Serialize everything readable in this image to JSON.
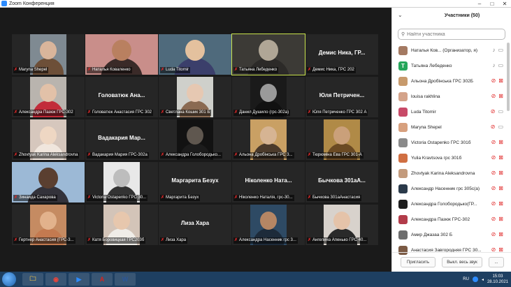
{
  "window": {
    "title": "Zoom Конференция",
    "minimize": "–",
    "maximize": "□",
    "close": "✕"
  },
  "gallery": {
    "tiles": [
      {
        "label": "Maryna Shepel",
        "center": "",
        "photo": "face",
        "bg": "#7f8a92",
        "skin": "#d9b59b",
        "cloth": "#6d4f38"
      },
      {
        "label": "Наталья Коваленко",
        "center": "",
        "photo": "full",
        "bg": "#c98e8a",
        "skin": "#b98060",
        "cloth": "#3a2a28"
      },
      {
        "label": "Luda Titomir",
        "center": "",
        "photo": "full",
        "bg": "#4f6a7c",
        "skin": "#e4c19e",
        "cloth": "#3b3f6b"
      },
      {
        "label": "Татьяна Лебеденко",
        "center": "",
        "photo": "full",
        "bg": "#3c3a36",
        "skin": "#b0a696",
        "cloth": "#2c2a28",
        "active": true
      },
      {
        "label": "Демис Ника, ГРС 202",
        "center": "Демис Ника, ГР...",
        "photo": ""
      },
      {
        "label": "Александра Пазюк ГРС-302",
        "center": "",
        "photo": "face",
        "bg": "#b9b4ae",
        "skin": "#e2c1a8",
        "cloth": "#c22c3a"
      },
      {
        "label": "Головатюк Анастасия ГРС 302",
        "center": "Головатюк Ана...",
        "photo": ""
      },
      {
        "label": "Светлана Кошик 301 Б",
        "center": "",
        "photo": "face",
        "bg": "#cfd0cb",
        "skin": "#e6c8b2",
        "cloth": "#8a6a52"
      },
      {
        "label": "Данил Душило (грс-302а)",
        "center": "",
        "photo": "face",
        "bg": "#1a1a1a",
        "skin": "#9a9a9a",
        "cloth": "#111111"
      },
      {
        "label": "Юля Петриченко ГРС 302 А",
        "center": "Юля Петричен...",
        "photo": ""
      },
      {
        "label": "Zhovtyak Karina Aleksandrovna",
        "center": "",
        "photo": "face",
        "bg": "#d6c7bd",
        "skin": "#eed7c3",
        "cloth": "#f0e6dd"
      },
      {
        "label": "Вадакария Мария ГРС-302а",
        "center": "Вадакария Мар...",
        "photo": ""
      },
      {
        "label": "Александра Голобородько...",
        "center": "",
        "photo": "face",
        "bg": "#121212",
        "skin": "#5f574f",
        "cloth": "#1c1c1c"
      },
      {
        "label": "Альона Дробінська ГРС 3...",
        "center": "",
        "photo": "face",
        "bg": "#c9a064",
        "skin": "#d6b493",
        "cloth": "#4b3a2b"
      },
      {
        "label": "Тюрюміна Ева ГРС 301-А",
        "center": "",
        "photo": "face",
        "bg": "#b08a47",
        "skin": "#caa07a",
        "cloth": "#6b4a23"
      },
      {
        "label": "Зинаида Сахарова",
        "center": "",
        "photo": "full",
        "bg": "#9cb9d6",
        "skin": "#5a3f30",
        "cloth": "#33323a"
      },
      {
        "label": "Victoria Ostapenko  ГРС 30...",
        "center": "",
        "photo": "face",
        "bg": "#e8e8e8",
        "skin": "#bdbdbd",
        "cloth": "#333333"
      },
      {
        "label": "Маргарита Безух",
        "center": "Маргарита Безух",
        "photo": ""
      },
      {
        "label": "Ніколенко Наталія, грс-30...",
        "center": "Ніколенко Ната...",
        "photo": ""
      },
      {
        "label": "Бычкова 301аАнастасия",
        "center": "Бычкова 301аА...",
        "photo": ""
      },
      {
        "label": "Гертнер Анастасия (ГРС-3...",
        "center": "",
        "photo": "face",
        "bg": "#c58b62",
        "skin": "#e2b28c",
        "cloth": "#c47a50"
      },
      {
        "label": "Катя Боровицкая ГРС203б",
        "center": "",
        "photo": "face",
        "bg": "#d3c4b8",
        "skin": "#e7c7ad",
        "cloth": "#f0ede8"
      },
      {
        "label": "Лиза Хара",
        "center": "Лиза Хара",
        "photo": ""
      },
      {
        "label": "Александра Насенник грс 3...",
        "center": "",
        "photo": "face",
        "bg": "#2e4a64",
        "skin": "#b58664",
        "cloth": "#1d2b3a"
      },
      {
        "label": "Ангелина Апенько ГРС 40...",
        "center": "",
        "photo": "face",
        "bg": "#d8d2cc",
        "skin": "#e5c3a9",
        "cloth": "#2a2a2a"
      }
    ]
  },
  "participants": {
    "title": "Участники (50)",
    "search_placeholder": "Найти участника",
    "items": [
      {
        "name": "Наталья Ков... (Организатор, я)",
        "avatar": "#a47a62",
        "letter": "",
        "mic": "plain",
        "cam": "plain"
      },
      {
        "name": "Татьяна Лебеденко",
        "avatar": "#26a65b",
        "letter": "Т",
        "mic": "plain-solid",
        "cam": "plain"
      },
      {
        "name": "Альона Дробінська ГРС 302Б",
        "avatar": "#c79a6c",
        "letter": "",
        "mic": "muted",
        "cam": "muted"
      },
      {
        "name": "louisa rakhlina",
        "avatar": "#d4a38a",
        "letter": "",
        "mic": "muted",
        "cam": "muted"
      },
      {
        "name": "Luda Titomir",
        "avatar": "#c84a68",
        "letter": "",
        "mic": "muted",
        "cam": "plain"
      },
      {
        "name": "Maryna Shepel",
        "avatar": "#d7a07e",
        "letter": "",
        "mic": "muted",
        "cam": "plain"
      },
      {
        "name": "Victoria Ostapenko  ГРС 301б",
        "avatar": "#8a8a8a",
        "letter": "",
        "mic": "muted",
        "cam": "muted"
      },
      {
        "name": "Yulia Kravtsova грс 301б",
        "avatar": "#d06f42",
        "letter": "",
        "mic": "muted",
        "cam": "muted"
      },
      {
        "name": "Zhovtyak Karina Aleksandrovna",
        "avatar": "#c39b7d",
        "letter": "",
        "mic": "muted",
        "cam": "muted"
      },
      {
        "name": "Александр Насенник грс 305с(а)",
        "avatar": "#2b3a4a",
        "letter": "",
        "mic": "muted",
        "cam": "muted"
      },
      {
        "name": "Александра Голобородько(ГР...",
        "avatar": "#1e1e1e",
        "letter": "",
        "mic": "muted",
        "cam": "muted"
      },
      {
        "name": "Александра Пазюк ГРС-302",
        "avatar": "#b23c4a",
        "letter": "",
        "mic": "muted",
        "cam": "muted"
      },
      {
        "name": "Амир Джазаа 302 Б",
        "avatar": "#6d6d6d",
        "letter": "",
        "mic": "muted",
        "cam": "muted"
      },
      {
        "name": "Анастасия Завгородняя ГРС 30...",
        "avatar": "#7b5a44",
        "letter": "",
        "mic": "muted",
        "cam": "muted"
      }
    ],
    "invite_label": "Пригласить",
    "mute_all_label": "Выкл. весь звук",
    "more_label": "..."
  },
  "taskbar": {
    "apps": [
      {
        "name": "explorer",
        "glyph": "🗀",
        "color": "#f0c24a"
      },
      {
        "name": "chrome",
        "glyph": "◉",
        "color": "#e8453c"
      },
      {
        "name": "zoom",
        "glyph": "▶",
        "color": "#2d8cff"
      },
      {
        "name": "acrobat",
        "glyph": "A",
        "color": "#d8231d"
      },
      {
        "name": "word",
        "glyph": "W",
        "color": "#2b579a"
      }
    ],
    "lang": "RU",
    "time": "15:03",
    "date": "28.10.2021"
  }
}
